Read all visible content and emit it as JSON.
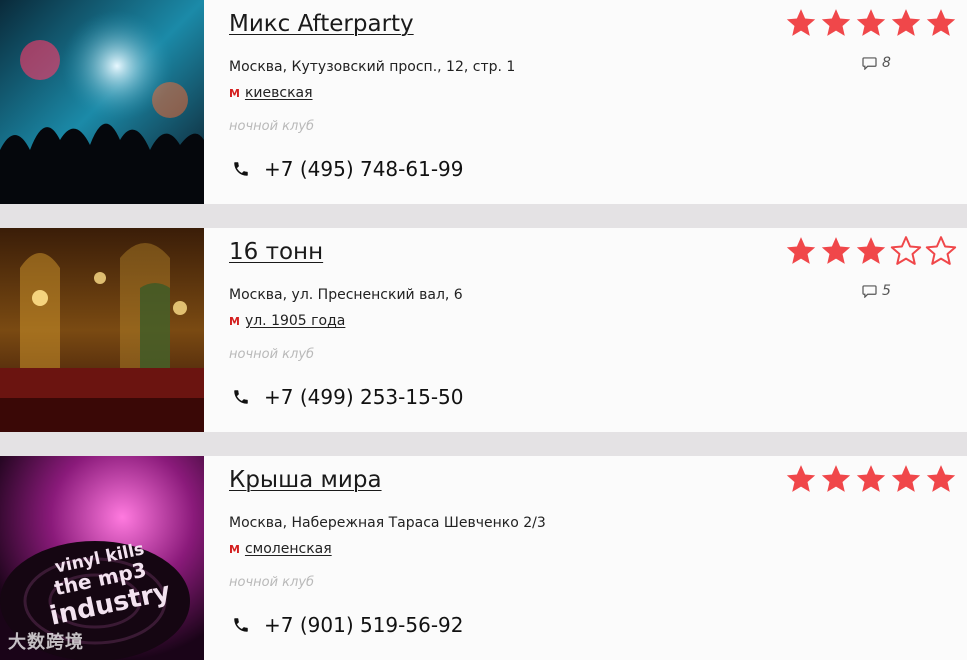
{
  "venues": [
    {
      "title": "Микс Afterparty",
      "address": "Москва, Кутузовский просп., 12, стр. 1",
      "metro": "киевская",
      "category": "ночной клуб",
      "phone": "+7 (495) 748-61-99",
      "rating": 5,
      "comments": "8"
    },
    {
      "title": "16 тонн",
      "address": "Москва, ул. Пресненский вал, 6",
      "metro": "ул. 1905 года",
      "category": "ночной клуб",
      "phone": "+7 (499) 253-15-50",
      "rating": 3,
      "comments": "5"
    },
    {
      "title": "Крыша мира",
      "address": "Москва, Набережная Тараса Шевченко 2/3",
      "metro": "смоленская",
      "category": "ночной клуб",
      "phone": "+7 (901) 519-56-92",
      "rating": 5,
      "comments": ""
    }
  ],
  "metro_icon": "М",
  "thumb3_text": [
    "vinyl kills",
    "the mp3",
    "industry"
  ],
  "watermark": "大数跨境",
  "colors": {
    "star": "#f0474a",
    "metro": "#d41f1f",
    "separator": "#e4e2e4"
  }
}
